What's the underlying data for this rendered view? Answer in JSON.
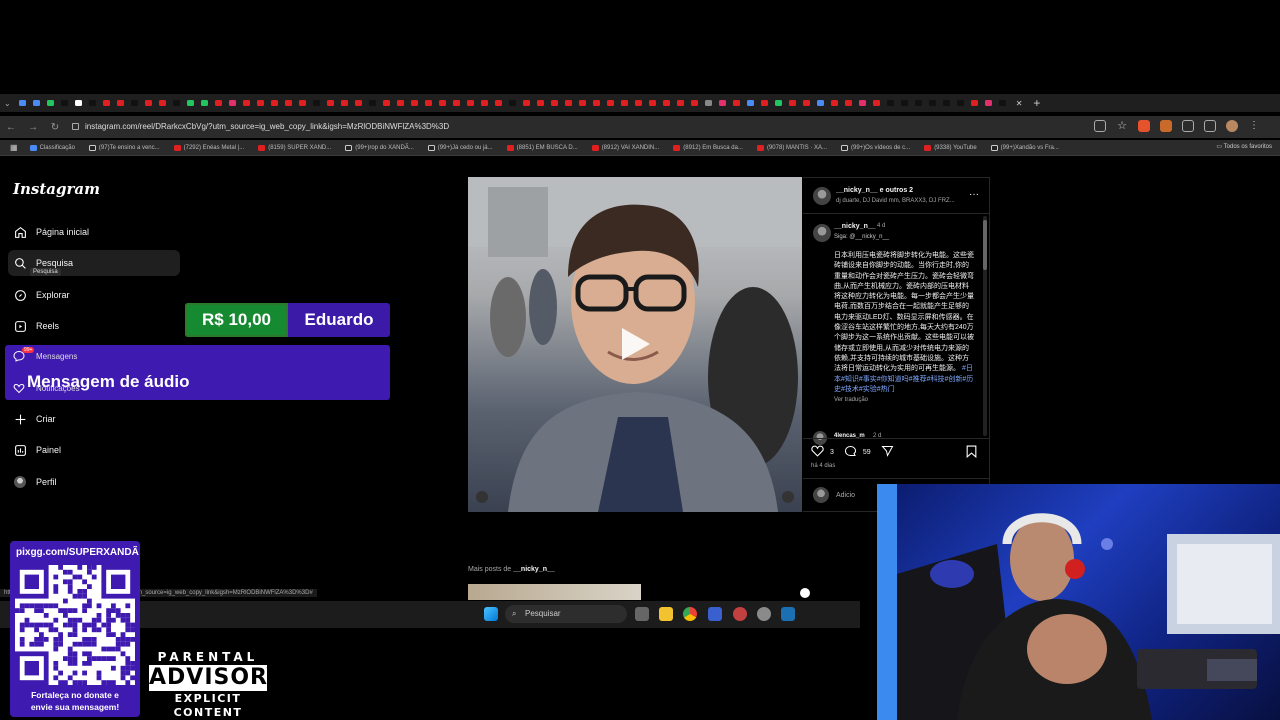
{
  "browser": {
    "url": "instagram.com/reel/DRarkcxCbVg/?utm_source=ig_web_copy_link&igsh=MzRlODBiNWFlZA%3D%3D",
    "new_tab": "+",
    "tab_colors": [
      "#4b8bf5",
      "#4b8bf5",
      "#22c55e",
      "#111",
      "#fff",
      "#111",
      "#e02020",
      "#e02020",
      "#111",
      "#e02020",
      "#e02020",
      "#111",
      "#22c55e",
      "#22c55e",
      "#e02020",
      "#e1306c",
      "#e02020",
      "#e02020",
      "#e02020",
      "#e02020",
      "#e02020",
      "#111",
      "#e02020",
      "#e02020",
      "#e02020",
      "#111",
      "#e02020",
      "#e02020",
      "#e02020",
      "#e02020",
      "#e02020",
      "#e02020",
      "#e02020",
      "#e02020",
      "#e02020",
      "#111",
      "#e02020",
      "#e02020",
      "#e02020",
      "#e02020",
      "#e02020",
      "#e02020",
      "#e02020",
      "#e02020",
      "#e02020",
      "#e02020",
      "#e02020",
      "#e02020",
      "#e02020",
      "#888",
      "#e1306c",
      "#e02020",
      "#4b8bf5",
      "#e02020",
      "#22c55e",
      "#e02020",
      "#e02020",
      "#4b8bf5",
      "#e02020",
      "#e02020",
      "#e1306c",
      "#e02020",
      "#111",
      "#111",
      "#111",
      "#111",
      "#111",
      "#111",
      "#e02020",
      "#e1306c",
      "#111"
    ],
    "bookmarks": [
      {
        "label": "Classificação",
        "kind": "blue"
      },
      {
        "label": "(97)Te ensino a venc...",
        "kind": "tiktok"
      },
      {
        "label": "(7292) Enéas Metal |...",
        "kind": "yt"
      },
      {
        "label": "(8159) SUPER XAND...",
        "kind": "yt"
      },
      {
        "label": "(99+)rop do XANDÃ...",
        "kind": "tiktok"
      },
      {
        "label": "(99+)Já cedo ou já...",
        "kind": "tiktok"
      },
      {
        "label": "(8851) EM BUSCA D...",
        "kind": "yt"
      },
      {
        "label": "(8912) VAI XANDIN...",
        "kind": "yt"
      },
      {
        "label": "(8912) Em Busca da...",
        "kind": "yt"
      },
      {
        "label": "(9078) MANTIS · XA...",
        "kind": "yt"
      },
      {
        "label": "(99+)Os vídeos de c...",
        "kind": "tiktok"
      },
      {
        "label": "(9338) YouTube",
        "kind": "yt"
      },
      {
        "label": "(99+)Xandão vs Fra...",
        "kind": "tiktok"
      }
    ],
    "all_bookmarks": "Todos os favoritos",
    "status_url": "https://www.instagram.com/reel/DRarkcxCbVg/?utm_source=ig_web_copy_link&igsh=MzRlODBiNWFlZA%3D%3D#"
  },
  "instagram": {
    "logo": "Instagram",
    "nav": [
      {
        "label": "Página inicial",
        "icon": "home-icon"
      },
      {
        "label": "Pesquisa",
        "icon": "search-icon"
      },
      {
        "label": "Explorar",
        "icon": "compass-icon"
      },
      {
        "label": "Reels",
        "icon": "reels-icon"
      },
      {
        "label": "Mensagens",
        "icon": "messenger-icon"
      },
      {
        "label": "Notificações",
        "icon": "heart-icon"
      },
      {
        "label": "Criar",
        "icon": "plus-icon"
      },
      {
        "label": "Painel",
        "icon": "chart-icon"
      },
      {
        "label": "Perfil",
        "icon": "avatar-icon"
      }
    ],
    "tooltip": "Pesquisa",
    "messages_badge": "99+",
    "post": {
      "author": "__nicky_n__",
      "header_suffix": "e outros 2",
      "collaborators": "dj duarte, DJ David mm, BRAXX3, DJ FRZ...",
      "caption_user": "__nicky_n__",
      "caption_time": "4 d",
      "follow_line": "Siga: @__nicky_n__",
      "caption": "日本利用压电瓷砖将脚步转化为电能。这些瓷砖铺设来自你脚步的动能。当你行走时,你的重量和动作会对瓷砖产生压力。瓷砖会轻微弯曲,从而产生机械应力。瓷砖内部的压电材料将这种应力转化为电能。每一步都会产生少量电荷,而数百万步结合在一起就能产生足够的电力来驱动LED灯、数码显示屏和传感器。在像涩谷车站这样繁忙的地方,每天大约有240万个脚步为这一系统作出贡献。这些电能可以被储存或立即使用,从而减少对传统电力来源的依赖,并支持可持续的城市基础设施。这种方法将日常运动转化为实用的可再生能源。",
      "hashtags": "#日本#知识#事实#你知道吗#推荐#科技#创新#历史#技术#实验#热门",
      "see_translation": "Ver tradução",
      "next_comment_user": "4lencas_m",
      "next_comment_time": "2 d",
      "likes": "3",
      "comments": "59",
      "posted": "há 4 dias",
      "add_comment": "Adicio",
      "more_posts_prefix": "Mais posts de",
      "more_posts_user": "__nicky_n__"
    }
  },
  "donation": {
    "amount": "R$ 10,00",
    "name": "Eduardo",
    "message": "Mensagem de áudio"
  },
  "qr": {
    "title": "pixgg.com/SUPERXANDÃ",
    "footer_line1": "Fortaleça no donate e",
    "footer_line2": "envie sua mensagem!"
  },
  "advisory": {
    "line1": "PARENTAL",
    "line2": "ADVISORY",
    "line3": "EXPLICIT CONTENT"
  },
  "taskbar": {
    "search_placeholder": "Pesquisar"
  }
}
